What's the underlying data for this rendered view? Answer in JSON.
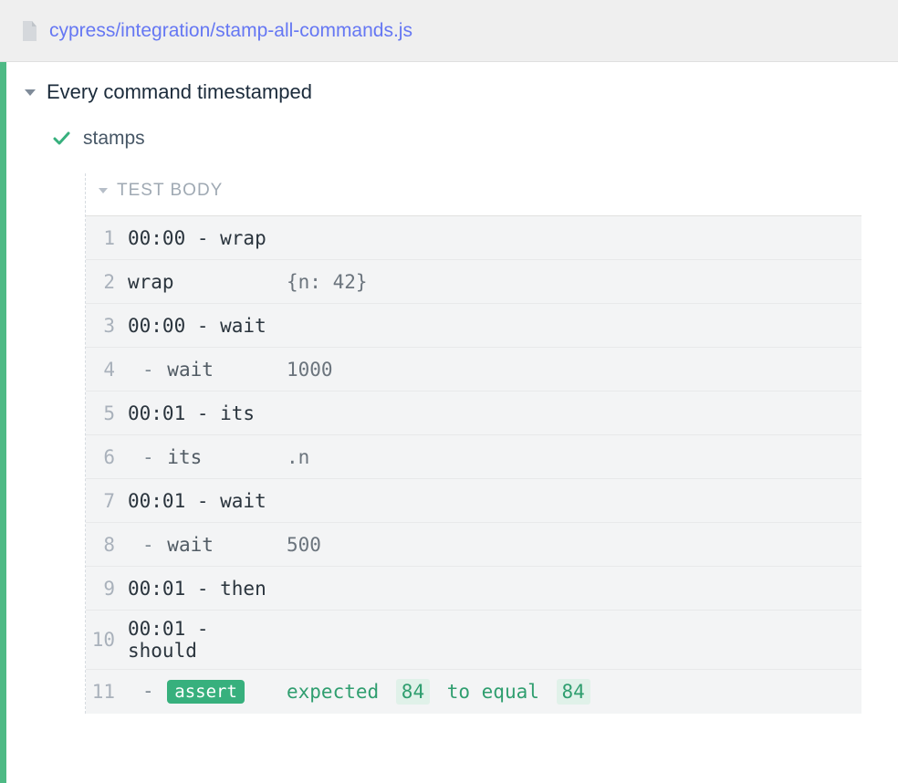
{
  "header": {
    "file_path": "cypress/integration/stamp-all-commands.js"
  },
  "suite": {
    "title": "Every command timestamped"
  },
  "test": {
    "title": "stamps"
  },
  "body": {
    "label": "TEST BODY",
    "rows": [
      {
        "num": "1",
        "type": "parent",
        "cmd": "00:00 - wrap",
        "arg": ""
      },
      {
        "num": "2",
        "type": "parent",
        "cmd": "wrap",
        "arg": "{n: 42}"
      },
      {
        "num": "3",
        "type": "parent",
        "cmd": "00:00 - wait",
        "arg": ""
      },
      {
        "num": "4",
        "type": "child",
        "cmd": "wait",
        "arg": "1000"
      },
      {
        "num": "5",
        "type": "parent",
        "cmd": "00:01 - its",
        "arg": ""
      },
      {
        "num": "6",
        "type": "child",
        "cmd": "its",
        "arg": ".n"
      },
      {
        "num": "7",
        "type": "parent",
        "cmd": "00:01 - wait",
        "arg": ""
      },
      {
        "num": "8",
        "type": "child",
        "cmd": "wait",
        "arg": "500"
      },
      {
        "num": "9",
        "type": "parent",
        "cmd": "00:01 - then",
        "arg": ""
      },
      {
        "num": "10",
        "type": "parent",
        "cmd": "00:01 - should",
        "arg": ""
      }
    ],
    "assert": {
      "num": "11",
      "pill": "assert",
      "pre": "expected",
      "lhs": "84",
      "mid": "to equal",
      "rhs": "84"
    }
  }
}
